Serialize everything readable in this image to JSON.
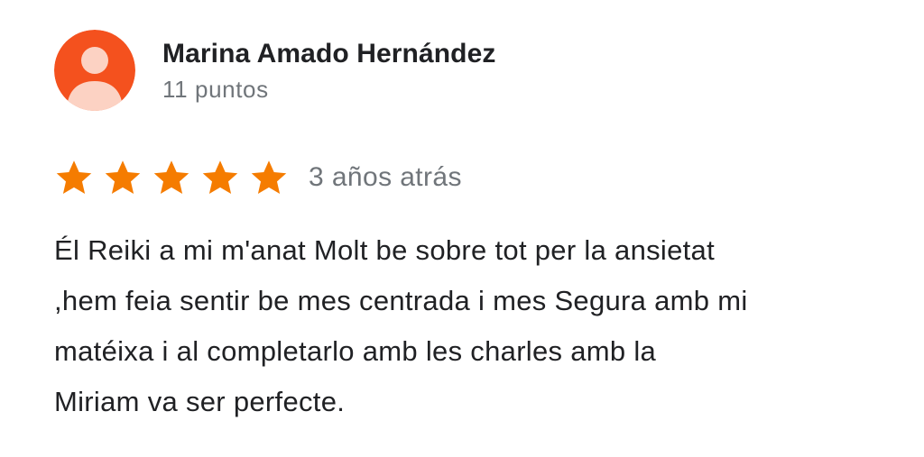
{
  "reviewer": {
    "name": "Marina Amado Hernández",
    "points": "11 puntos",
    "avatar_icon": "person-icon",
    "avatar_color": "#F4511E"
  },
  "rating": {
    "stars": 5,
    "max_stars": 5,
    "star_color": "#F57C00",
    "time_ago": "3 años atrás"
  },
  "review": {
    "text": "Él Reiki a mi m'anat Molt be sobre tot per la ansietat\n,hem feia sentir be mes centrada i mes Segura amb mi\nmatéixa i al completarlo amb les charles amb la\nMiriam va ser perfecte."
  }
}
